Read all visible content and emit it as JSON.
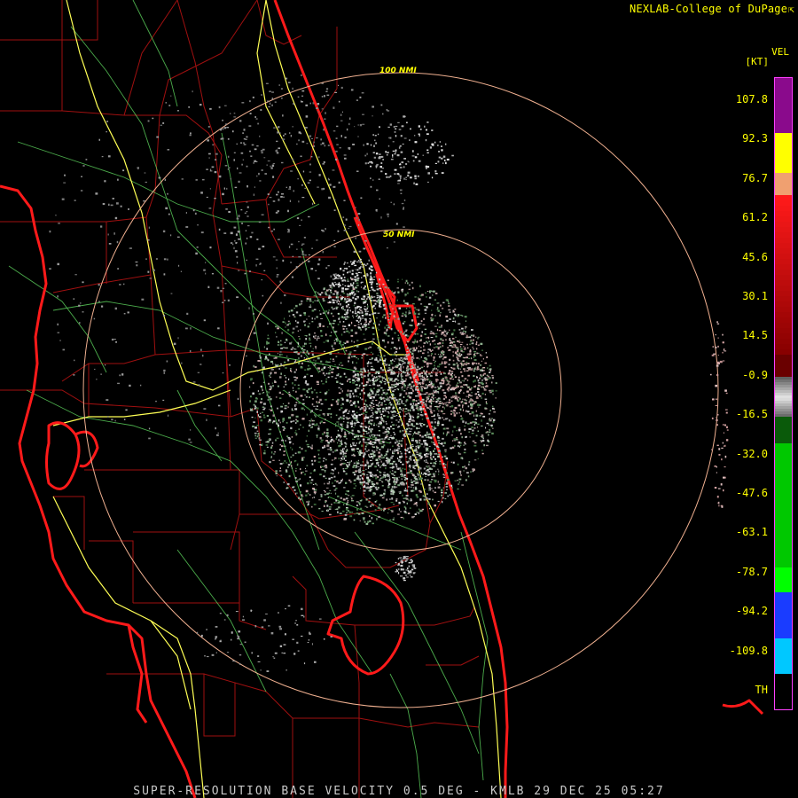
{
  "credit": {
    "text": "NEXLAB-College of DuPage",
    "icon": "external-link-icon"
  },
  "footer": {
    "text": "SUPER-RESOLUTION BASE VELOCITY 0.5 DEG - KMLB 29 DEC 25 05:27"
  },
  "range_rings": [
    {
      "label": "100 NMI"
    },
    {
      "label": "50 NMI"
    }
  ],
  "legend": {
    "product": "VEL",
    "units": "[KT]",
    "ticks": [
      "107.8",
      "92.3",
      "76.7",
      "61.2",
      "45.6",
      "30.1",
      "14.5",
      "-0.9",
      "-16.5",
      "-32.0",
      "-47.6",
      "-63.1",
      "-78.7",
      "-94.2",
      "-109.8"
    ],
    "th_label": "TH",
    "colors": {
      "purple": "#8a0a8c",
      "yellow": "#ffff00",
      "peach": "#f0a070",
      "red": "#ff1a1a",
      "dark_red": "#6a0000",
      "gray": "#a0a0a0",
      "dark_green": "#0a5a0a",
      "green": "#00c800",
      "bright_green": "#00ff00",
      "blue": "#1a3cff",
      "cyan": "#00c8ff"
    }
  },
  "map_colors": {
    "coastline": "#ff1a1a",
    "county_lines": "#a01010",
    "highways": "#ffff55",
    "roads": "#5fd85f",
    "range_rings": "#f0b090"
  }
}
